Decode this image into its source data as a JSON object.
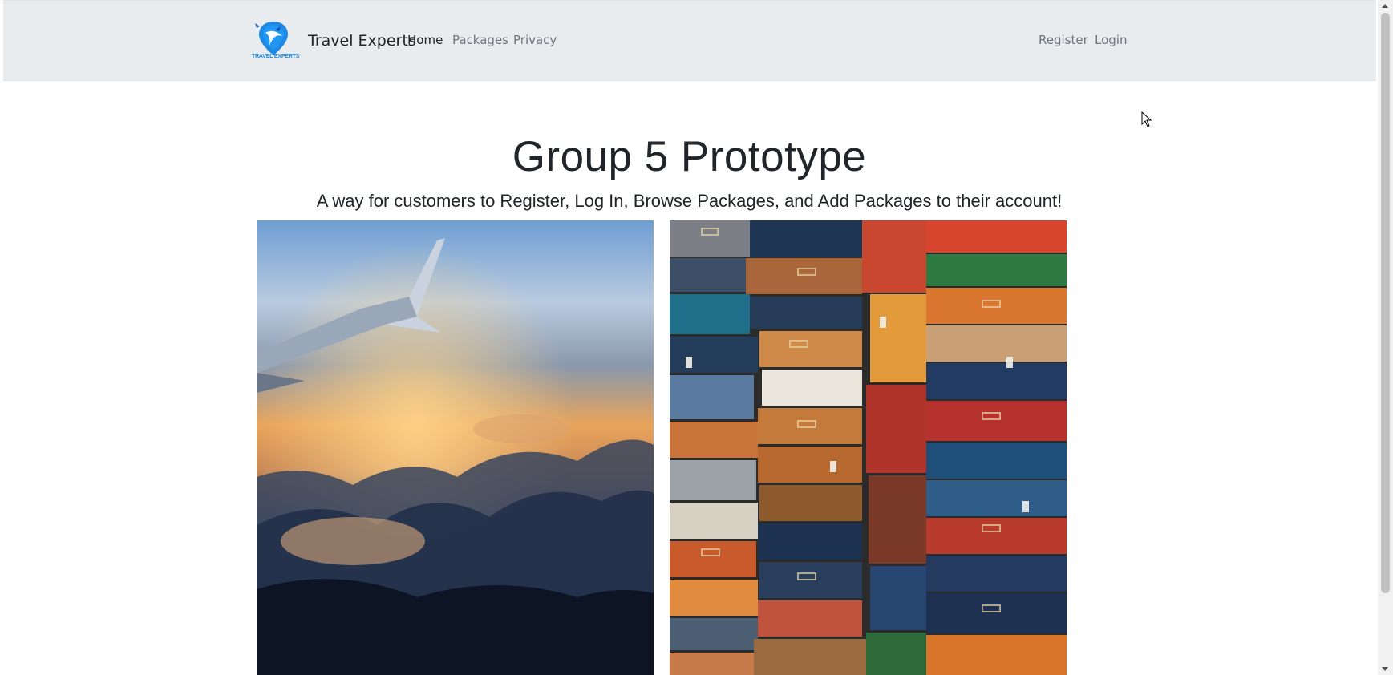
{
  "navbar": {
    "logo_text": "TRAVEL EXPERTS",
    "brand": "Travel Experts",
    "links": [
      {
        "label": "Home",
        "active": true
      },
      {
        "label": "Packages",
        "active": false
      },
      {
        "label": "Privacy",
        "active": false
      }
    ],
    "auth_links": [
      {
        "label": "Register"
      },
      {
        "label": "Login"
      }
    ]
  },
  "hero": {
    "title": "Group 5 Prototype",
    "subtitle": "A way for customers to Register, Log In, Browse Packages, and Add Packages to their account!"
  },
  "images": [
    {
      "name": "airplane-wing-clouds-image"
    },
    {
      "name": "stacked-suitcases-image"
    }
  ],
  "colors": {
    "navbar_bg": "#e9ecef",
    "nav_link": "#6c757d",
    "nav_link_active": "#212529",
    "logo_blue": "#1e88e5"
  }
}
